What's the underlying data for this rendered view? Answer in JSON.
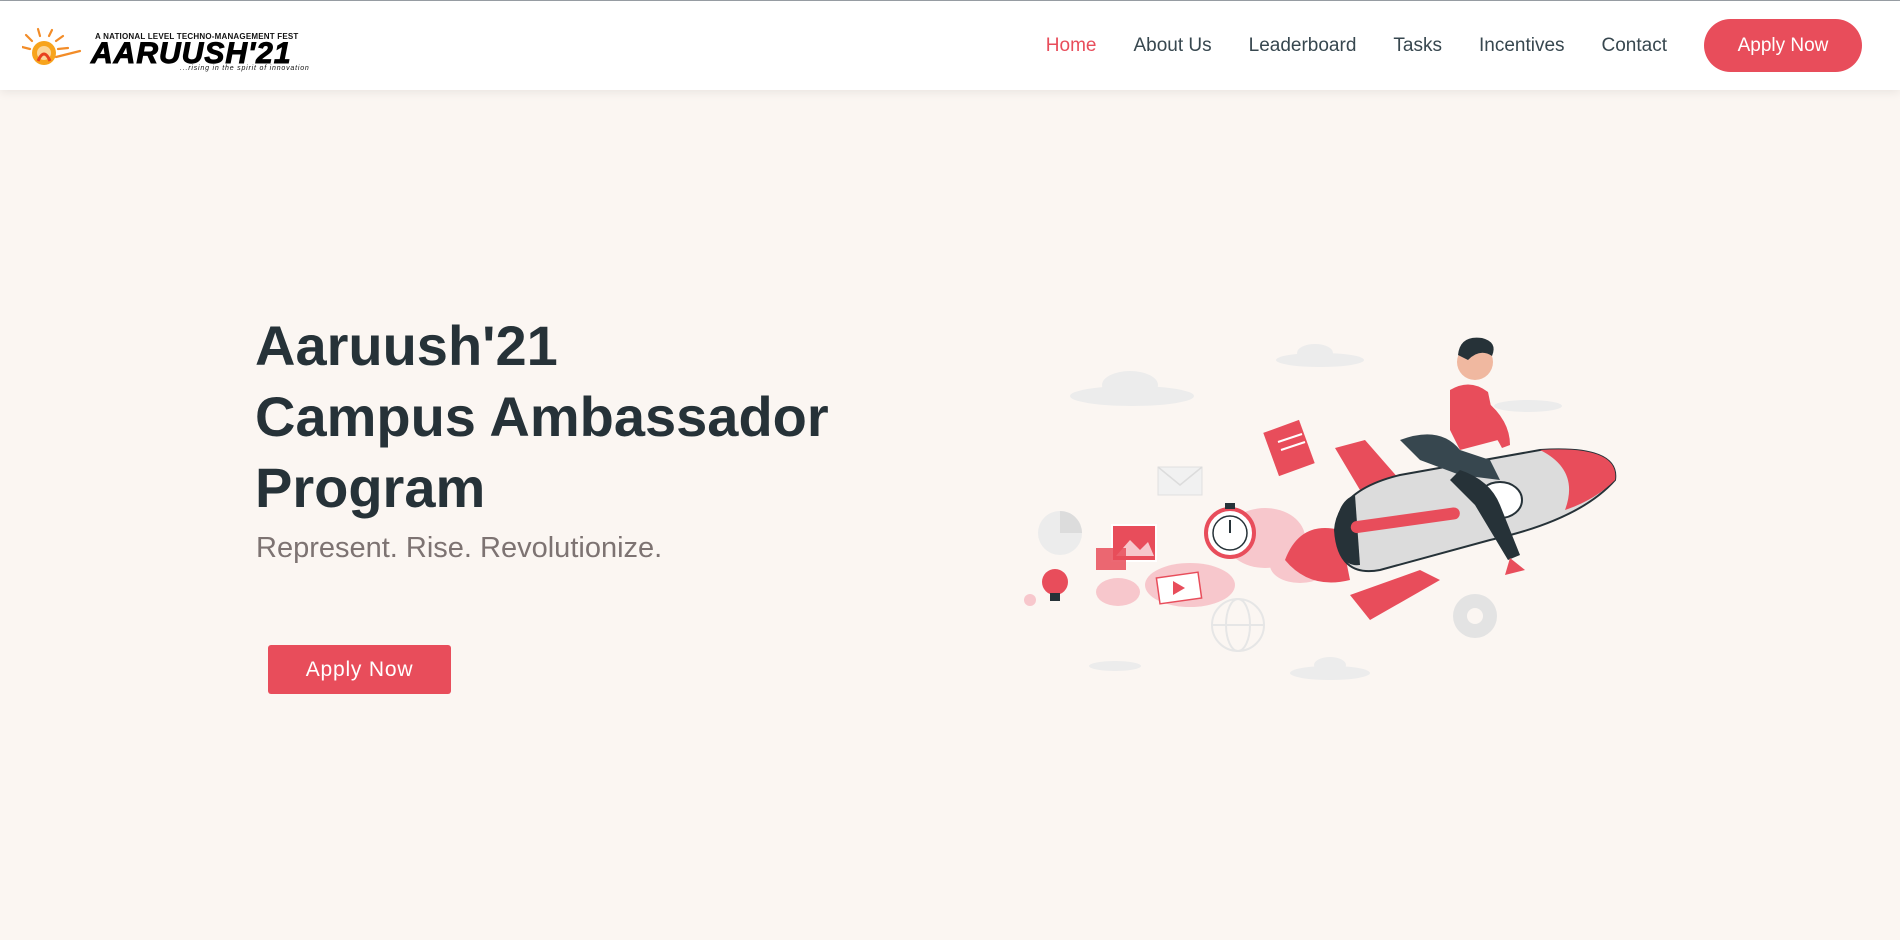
{
  "brand": {
    "small_text": "A NATIONAL LEVEL TECHNO-MANAGEMENT FEST",
    "name": "AARUUSH'21",
    "tagline": "...rising in the spirit of innovation",
    "accent": "#e84d5b",
    "logo_icon": "sun-logo-icon"
  },
  "nav": {
    "items": [
      {
        "label": "Home",
        "active": true
      },
      {
        "label": "About Us",
        "active": false
      },
      {
        "label": "Leaderboard",
        "active": false
      },
      {
        "label": "Tasks",
        "active": false
      },
      {
        "label": "Incentives",
        "active": false
      },
      {
        "label": "Contact",
        "active": false
      }
    ],
    "apply_label": "Apply Now"
  },
  "hero": {
    "title_lines": [
      "Aaruush'21",
      "Campus Ambassador",
      "Program"
    ],
    "subtitle": "Represent. Rise. Revolutionize.",
    "apply_label": "Apply Now",
    "illustration": "rocket-rider-illustration"
  },
  "colors": {
    "background": "#fbf6f2",
    "accent": "#e84d5b",
    "heading": "#263238",
    "subtitle": "#7d7372"
  }
}
